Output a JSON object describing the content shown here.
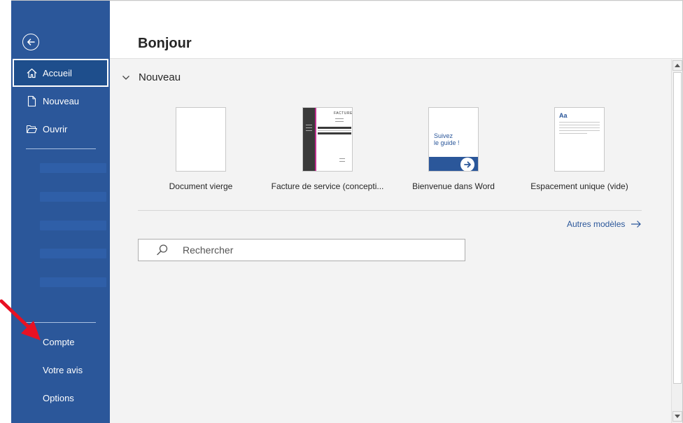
{
  "header": {
    "title": "Bonjour"
  },
  "sidebar": {
    "items": [
      {
        "label": "Accueil",
        "icon": "home-icon"
      },
      {
        "label": "Nouveau",
        "icon": "new-document-icon"
      },
      {
        "label": "Ouvrir",
        "icon": "open-folder-icon"
      }
    ],
    "bottom_items": [
      {
        "label": "Compte"
      },
      {
        "label": "Votre avis"
      },
      {
        "label": "Options"
      }
    ]
  },
  "main": {
    "section_title": "Nouveau",
    "templates": [
      {
        "label": "Document vierge"
      },
      {
        "label": "Facture de service (concepti...",
        "thumb_title": "FACTURE"
      },
      {
        "label": "Bienvenue dans Word",
        "thumb_text": "Suivez\nle guide !"
      },
      {
        "label": "Espacement unique (vide)",
        "thumb_text": "Aa"
      }
    ],
    "more_templates": "Autres modèles",
    "search": {
      "placeholder": "Rechercher"
    }
  },
  "colors": {
    "sidebar": "#2b579a",
    "accent": "#2b579a",
    "annotation": "#e81123"
  }
}
